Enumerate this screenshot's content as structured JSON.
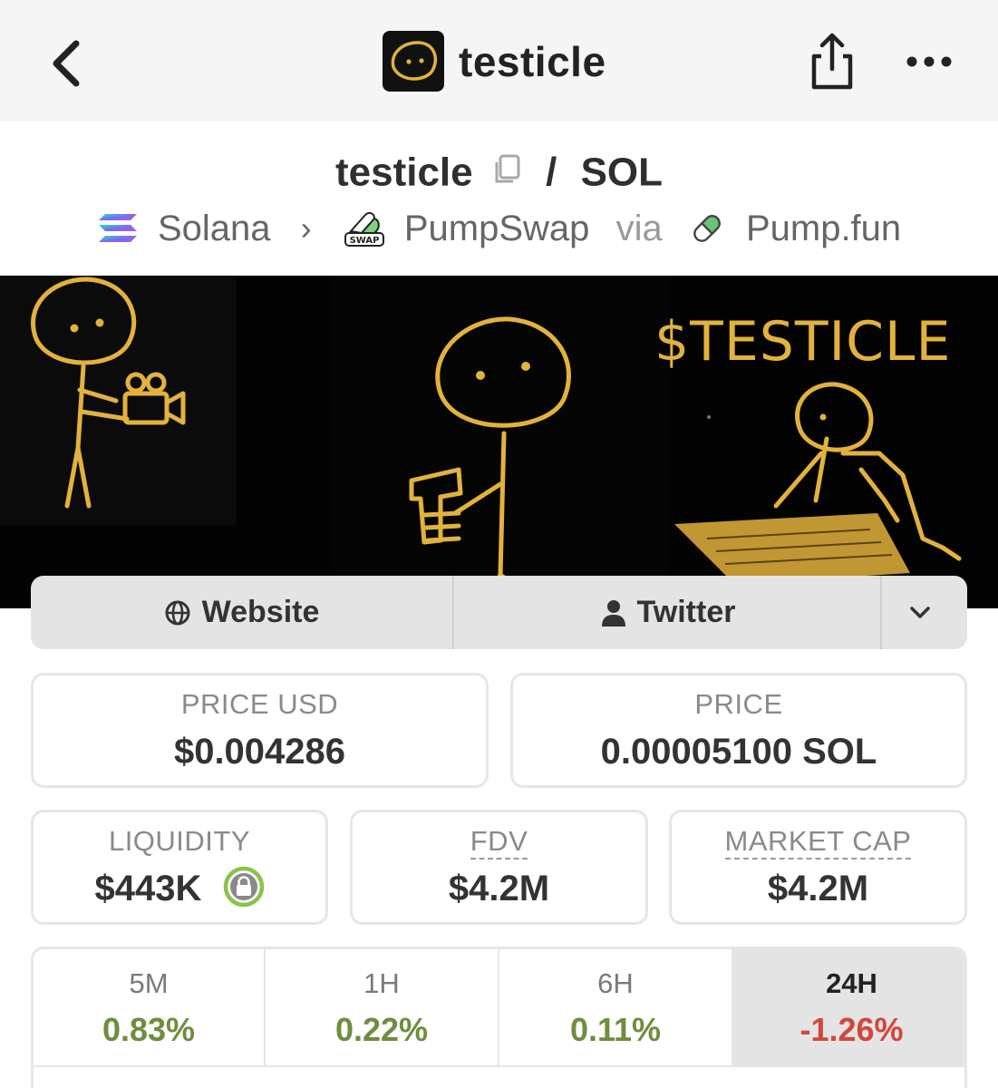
{
  "header": {
    "title": "testicle",
    "icons": {
      "back": "chevron-left-icon",
      "share": "share-icon",
      "more": "more-horizontal-icon"
    }
  },
  "pair": {
    "base": "testicle",
    "separator": "/",
    "quote": "SOL"
  },
  "chain": {
    "network": "Solana",
    "dex": "PumpSwap",
    "dex_badge": "SWAP",
    "via_label": "via",
    "launchpad": "Pump.fun"
  },
  "banner": {
    "ticker": "$TESTICLE"
  },
  "links": {
    "website": "Website",
    "twitter": "Twitter"
  },
  "stats": {
    "price_usd": {
      "label": "PRICE USD",
      "value": "$0.004286"
    },
    "price": {
      "label": "PRICE",
      "value": "0.00005100 SOL"
    },
    "liquidity": {
      "label": "LIQUIDITY",
      "value": "$443K"
    },
    "fdv": {
      "label": "FDV",
      "value": "$4.2M"
    },
    "market_cap": {
      "label": "MARKET CAP",
      "value": "$4.2M"
    }
  },
  "changes": [
    {
      "label": "5M",
      "value": "0.83%",
      "trend": "up"
    },
    {
      "label": "1H",
      "value": "0.22%",
      "trend": "up"
    },
    {
      "label": "6H",
      "value": "0.11%",
      "trend": "up"
    },
    {
      "label": "24H",
      "value": "-1.26%",
      "trend": "down",
      "selected": true
    }
  ],
  "colors": {
    "positive": "#6e8e3e",
    "negative": "#d2463b",
    "banner_gold": "#e3b23c",
    "lock_green": "#8bc34a"
  }
}
